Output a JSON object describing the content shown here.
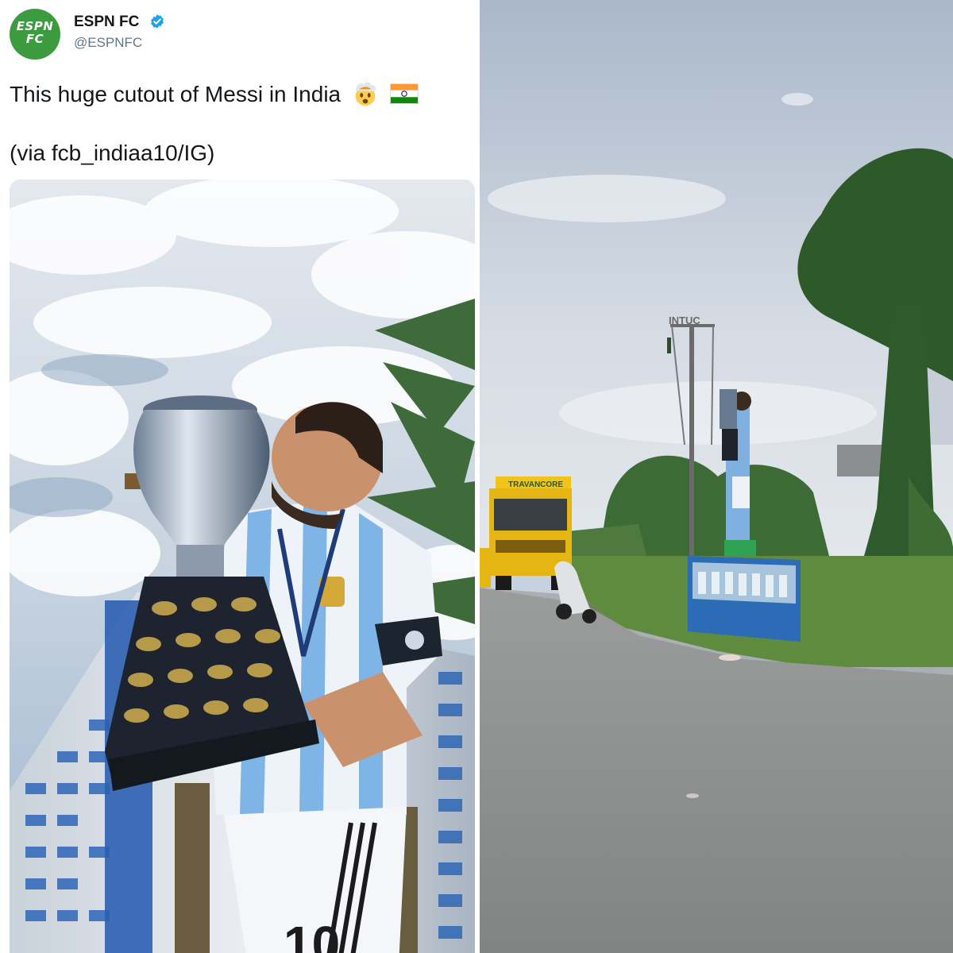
{
  "tweet": {
    "display_name": "ESPN FC",
    "handle": "@ESPNFC",
    "avatar_logo_lines": [
      "ESPN",
      "FC"
    ],
    "text": "This huge cutout of Messi in India",
    "via": "(via fcb_indiaa10/IG)",
    "emojis": [
      "exploding-head-emoji",
      "india-flag-emoji"
    ],
    "verified": true
  },
  "media_left": {
    "jersey_number": "10"
  },
  "media_right": {
    "bus_sign": "TRAVANCORE",
    "pole_sign": "INTUC"
  },
  "colors": {
    "espn_green": "#3d9b3f",
    "verified_blue": "#1da1f2",
    "text_primary": "#14171a",
    "text_secondary": "#657786"
  }
}
